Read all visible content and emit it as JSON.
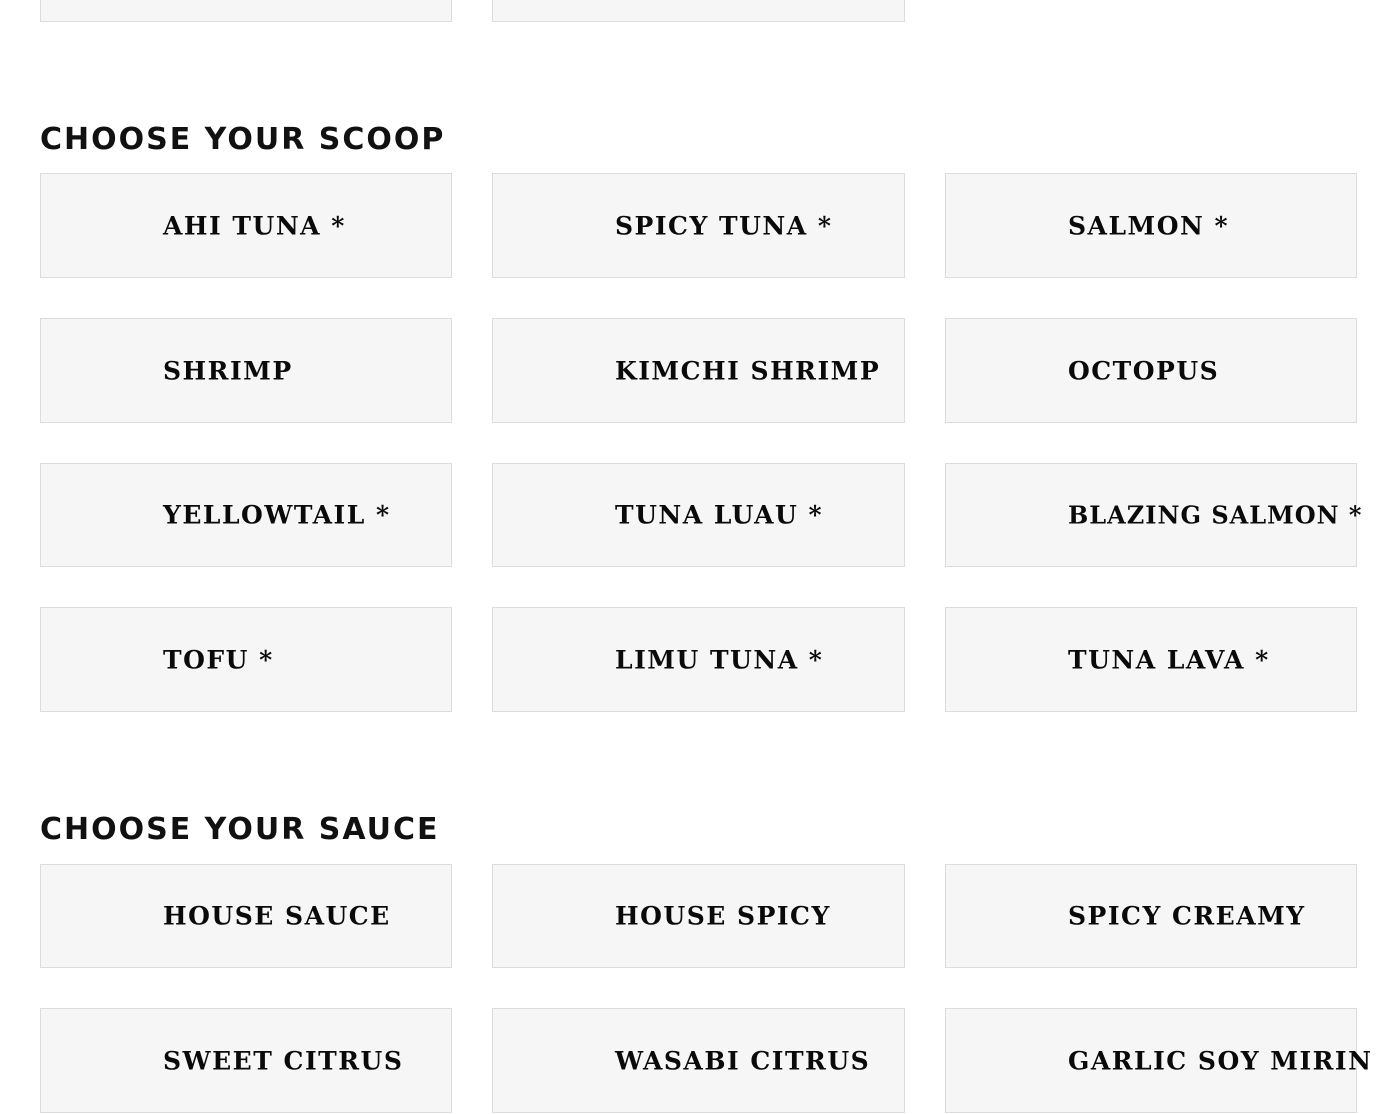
{
  "sections": [
    {
      "title": "CHOOSE YOUR SCOOP",
      "options": [
        {
          "label": "AHI TUNA *"
        },
        {
          "label": "SPICY TUNA *"
        },
        {
          "label": "SALMON *"
        },
        {
          "label": "SHRIMP"
        },
        {
          "label": "KIMCHI SHRIMP"
        },
        {
          "label": "OCTOPUS"
        },
        {
          "label": "YELLOWTAIL *"
        },
        {
          "label": "TUNA LUAU *"
        },
        {
          "label": "BLAZING SALMON *"
        },
        {
          "label": "TOFU *"
        },
        {
          "label": "LIMU TUNA *"
        },
        {
          "label": "TUNA LAVA *"
        }
      ]
    },
    {
      "title": "CHOOSE YOUR SAUCE",
      "options": [
        {
          "label": "HOUSE SAUCE"
        },
        {
          "label": "HOUSE SPICY"
        },
        {
          "label": "SPICY CREAMY"
        },
        {
          "label": "SWEET CITRUS"
        },
        {
          "label": "WASABI CITRUS"
        },
        {
          "label": "GARLIC SOY MIRIN"
        }
      ]
    }
  ]
}
